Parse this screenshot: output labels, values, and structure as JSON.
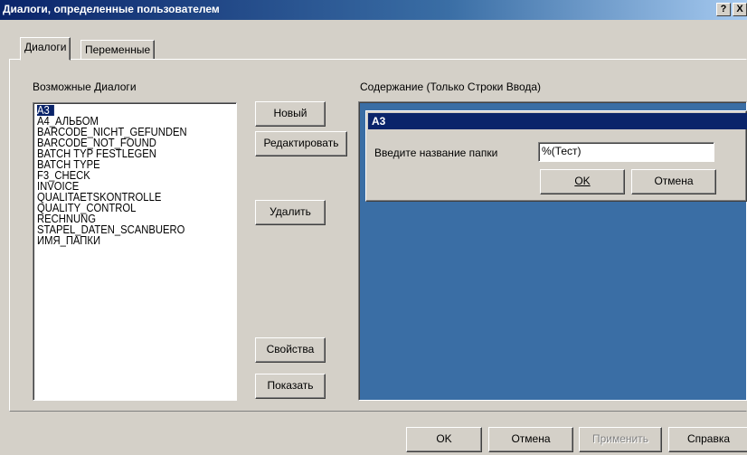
{
  "window": {
    "title": "Диалоги, определенные пользователем",
    "help_btn": "?",
    "close_btn": "X"
  },
  "tabs": [
    {
      "label": "Диалоги",
      "active": true
    },
    {
      "label": "Переменные",
      "active": false
    }
  ],
  "dialogs_section": {
    "label": "Возможные Диалоги",
    "items": [
      "A3",
      "A4_АЛЬБОМ",
      "BARCODE_NICHT_GEFUNDEN",
      "BARCODE_NOT_FOUND",
      "BATCH TYP FESTLEGEN",
      "BATCH TYPE",
      "F3_CHECK",
      "INVOICE",
      "QUALITAETSKONTROLLE",
      "QUALITY_CONTROL",
      "RECHNUNG",
      "STAPEL_DATEN_SCANBUERO",
      "ИМЯ_ПАПКИ"
    ],
    "selected": "A3"
  },
  "action_buttons": {
    "new": "Новый",
    "edit": "Редактировать",
    "delete": "Удалить",
    "properties": "Свойства",
    "show": "Показать"
  },
  "content_section": {
    "label": "Содержание (Только Строки Ввода)",
    "preview": {
      "title": "A3",
      "field_label": "Введите название папки",
      "field_value": "%(Тест)",
      "ok": "OK",
      "cancel": "Отмена"
    }
  },
  "footer": {
    "ok": "OK",
    "cancel": "Отмена",
    "apply": "Применить",
    "help": "Справка"
  },
  "colors": {
    "title_bar": "#0a246a",
    "preview_bg": "#3a6ea5",
    "face": "#d4d0c8"
  }
}
